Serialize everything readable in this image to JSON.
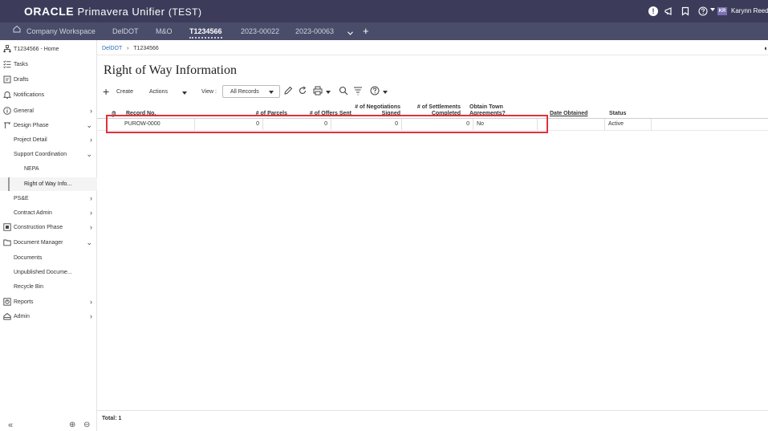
{
  "app": {
    "brand": "ORACLE",
    "product": "Primavera Unifier",
    "environment": "(TEST)",
    "user_initials": "KR",
    "user_name": "Karynn Reed",
    "colors": {
      "header_bg": "#3c3c5a",
      "nav_bg": "#4a4d6a",
      "highlight": "#e0313a",
      "link": "#2a6ebb"
    }
  },
  "nav": {
    "items": [
      {
        "label": "Company Workspace"
      },
      {
        "label": "DelDOT"
      },
      {
        "label": "M&O"
      },
      {
        "label": "T1234566",
        "active": true
      },
      {
        "label": "2023-00022"
      },
      {
        "label": "2023-00063"
      }
    ],
    "home_icon": "home-icon",
    "more_icon": "chevron-down-icon",
    "add_label": "+"
  },
  "sidebar": {
    "items": [
      {
        "label": "T1234566 - Home",
        "icon": "project-tree-icon"
      },
      {
        "label": "Tasks",
        "icon": "tasks-icon"
      },
      {
        "label": "Drafts",
        "icon": "drafts-icon"
      },
      {
        "label": "Notifications",
        "icon": "bell-icon"
      },
      {
        "label": "General",
        "icon": "info-icon",
        "chevron": "›"
      },
      {
        "label": "Design Phase",
        "icon": "design-icon",
        "chevron": "⌄"
      },
      {
        "label": "Project Detail",
        "chevron": "›"
      },
      {
        "label": "Support Coordination",
        "chevron": "⌄"
      },
      {
        "label": "NEPA"
      },
      {
        "label": "Right of Way Info..."
      },
      {
        "label": "PS&E",
        "chevron": "›"
      },
      {
        "label": "Contract Admin",
        "chevron": "›"
      },
      {
        "label": "Construction Phase",
        "icon": "construction-icon",
        "chevron": "›"
      },
      {
        "label": "Document Manager",
        "icon": "folder-icon",
        "chevron": "⌄"
      },
      {
        "label": "Documents"
      },
      {
        "label": "Unpublished Docume..."
      },
      {
        "label": "Recycle Bin"
      },
      {
        "label": "Reports",
        "icon": "reports-icon",
        "chevron": "›"
      },
      {
        "label": "Admin",
        "icon": "admin-icon",
        "chevron": "›"
      }
    ],
    "collapse_label": "«",
    "zoom_in_label": "⊕",
    "zoom_out_label": "⊖"
  },
  "breadcrumb": {
    "parent": "DelDOT",
    "separator": "›",
    "current": "T1234566"
  },
  "page": {
    "title": "Right of Way Information"
  },
  "toolbar": {
    "create_label": "Create",
    "actions_label": "Actions",
    "view_label": "View :",
    "view_value": "All Records"
  },
  "table": {
    "headers": {
      "attach": "🔗",
      "record_no": "Record No.",
      "parcels": "# of Parcels",
      "offers": "# of Offers Sent",
      "negotiations_1": "# of Negotiations",
      "negotiations_2": "Signed",
      "settlements_1": "# of Settlements",
      "settlements_2": "Completed",
      "obtain_1": "Obtain Town",
      "obtain_2": "Agreements?",
      "date_obtained": "Date Obtained",
      "status": "Status"
    },
    "rows": [
      {
        "record_no": "PUROW-0000",
        "parcels": "0",
        "offers": "0",
        "negotiations": "0",
        "settlements": "0",
        "obtain": "No",
        "date_obtained": "",
        "status": "Active"
      }
    ]
  },
  "footer": {
    "total_label": "Total: 1"
  }
}
